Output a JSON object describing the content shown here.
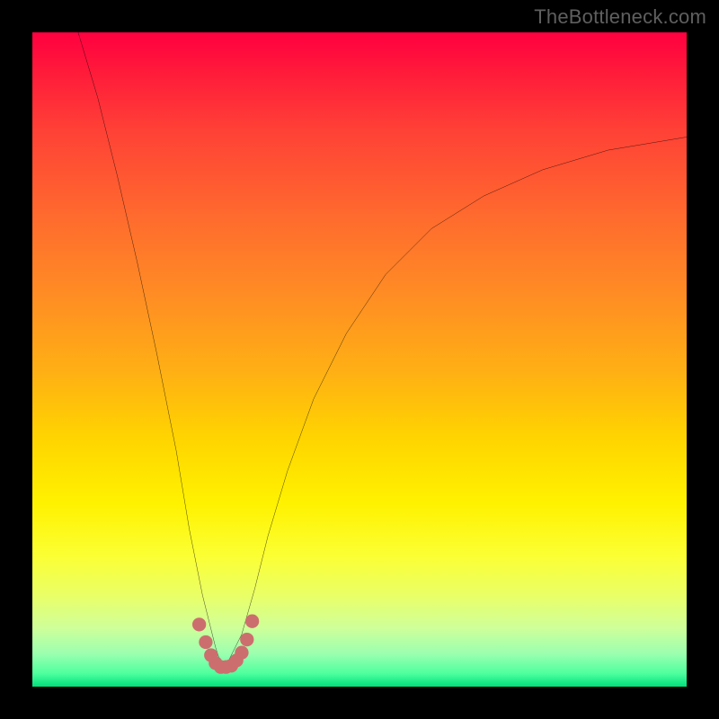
{
  "watermark": {
    "text": "TheBottleneck.com"
  },
  "chart_data": {
    "type": "line",
    "title": "",
    "xlabel": "",
    "ylabel": "",
    "xlim": [
      0,
      100
    ],
    "ylim": [
      0,
      100
    ],
    "grid": false,
    "legend": false,
    "curve": {
      "description": "V-shaped bottleneck curve; sharp minimum near x≈29, rising steeply on both sides",
      "x": [
        7,
        10,
        13,
        16,
        19,
        22,
        24,
        26,
        28,
        29,
        30,
        32,
        34,
        36,
        39,
        43,
        48,
        54,
        61,
        69,
        78,
        88,
        100
      ],
      "y": [
        100,
        90,
        78,
        65,
        51,
        36,
        24,
        14,
        6,
        3,
        4,
        8,
        15,
        23,
        33,
        44,
        54,
        63,
        70,
        75,
        79,
        82,
        84
      ]
    },
    "marker_band": {
      "note": "salmon dotted U marking the minimum region",
      "x": [
        25.5,
        26.5,
        27.3,
        28.0,
        28.8,
        29.6,
        30.4,
        31.2,
        32.0,
        32.8,
        33.6
      ],
      "y": [
        9.5,
        6.8,
        4.8,
        3.6,
        3.0,
        3.0,
        3.2,
        4.0,
        5.2,
        7.2,
        10.0
      ]
    },
    "colors": {
      "curve": "#000000",
      "marker": "#cd6e6e",
      "gradient_top": "#ff0040",
      "gradient_bottom": "#00e07a"
    }
  }
}
